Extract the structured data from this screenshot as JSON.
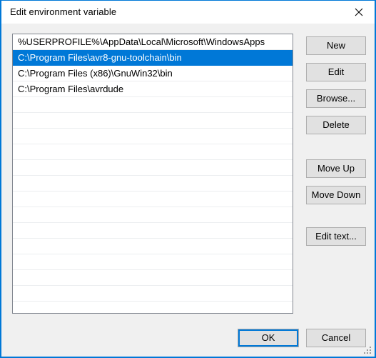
{
  "window": {
    "title": "Edit environment variable",
    "close_icon": "close-icon",
    "accent_color": "#0078d7",
    "body_color": "#f0f0f0",
    "button_face_color": "#e1e1e1",
    "button_border_color": "#adadad"
  },
  "list": {
    "name": "path-entries",
    "selected_index": 1,
    "entries": [
      "%USERPROFILE%\\AppData\\Local\\Microsoft\\WindowsApps",
      "C:\\Program Files\\avr8-gnu-toolchain\\bin",
      "C:\\Program Files (x86)\\GnuWin32\\bin",
      "C:\\Program Files\\avrdude"
    ],
    "empty_row_count": 14,
    "selection_background": "#0078d7",
    "selection_foreground": "#ffffff"
  },
  "side_buttons": {
    "new": "New",
    "edit": "Edit",
    "browse": "Browse...",
    "delete": "Delete",
    "move_up": "Move Up",
    "move_down": "Move Down",
    "edit_text": "Edit text..."
  },
  "bottom_buttons": {
    "ok": "OK",
    "cancel": "Cancel"
  },
  "resize_grip": "resize-grip"
}
